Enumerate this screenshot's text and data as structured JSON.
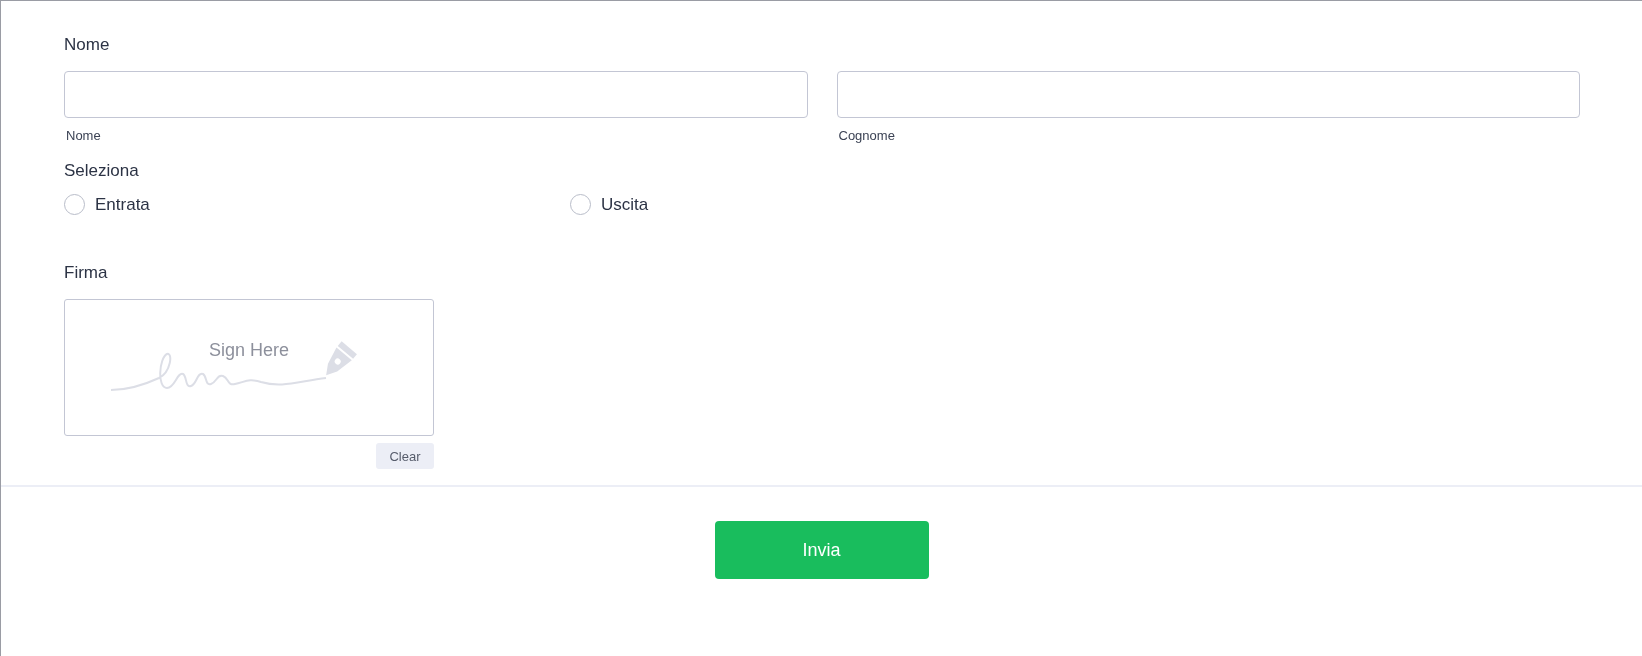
{
  "name_section": {
    "label": "Nome",
    "fields": [
      {
        "sublabel": "Nome"
      },
      {
        "sublabel": "Cognome"
      }
    ]
  },
  "select_section": {
    "label": "Seleziona",
    "options": [
      {
        "label": "Entrata",
        "selected": false
      },
      {
        "label": "Uscita",
        "selected": false
      }
    ]
  },
  "signature_section": {
    "label": "Firma",
    "placeholder": "Sign Here",
    "clear_button": "Clear"
  },
  "submit_button": "Invia"
}
